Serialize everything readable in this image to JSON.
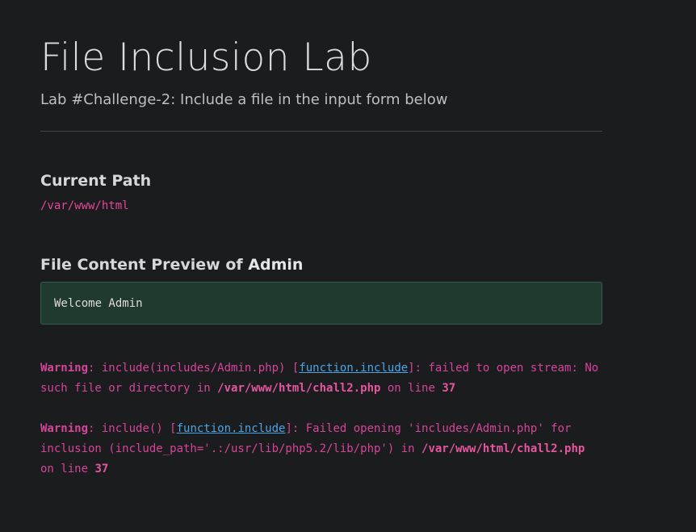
{
  "header": {
    "title": "File Inclusion Lab",
    "subtitle": "Lab #Challenge-2: Include a file in the input form below"
  },
  "current_path": {
    "heading": "Current Path",
    "value": "/var/www/html"
  },
  "preview": {
    "heading_prefix": "File Content Preview of ",
    "heading_name": "Admin",
    "content": "Welcome Admin"
  },
  "warnings": [
    {
      "label": "Warning",
      "before_link": ": include(includes/Admin.php) [",
      "link": "function.include",
      "after_link": "]: failed to open stream: No such file or directory in ",
      "file": "/var/www/html/chall2.php",
      "on_line": " on line ",
      "line": "37"
    },
    {
      "label": "Warning",
      "before_link": ": include() [",
      "link": "function.include",
      "after_link": "]: Failed opening 'includes/Admin.php' for inclusion (include_path='.:/usr/lib/php5.2/lib/php') in ",
      "file": "/var/www/html/chall2.php",
      "on_line": " on line ",
      "line": "37"
    }
  ],
  "colors": {
    "background": "#1b1c1e",
    "accent_pink": "#d6449a",
    "link_blue": "#4aa5e8",
    "preview_bg": "#213a30"
  }
}
